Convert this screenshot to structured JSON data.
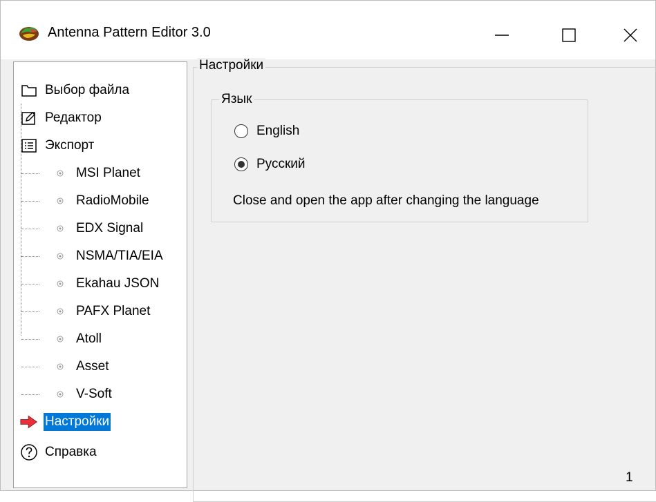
{
  "window": {
    "title": "Antenna Pattern Editor 3.0",
    "icon": "app-logo-icon",
    "controls": [
      "minimize-icon",
      "maximize-icon",
      "close-icon"
    ]
  },
  "sidebar": {
    "items": [
      {
        "label": "Выбор файла",
        "icon": "folder-icon"
      },
      {
        "label": "Редактор",
        "icon": "edit-icon"
      },
      {
        "label": "Экспорт",
        "icon": "list-icon",
        "children": [
          {
            "label": "MSI Planet"
          },
          {
            "label": "RadioMobile"
          },
          {
            "label": "EDX Signal"
          },
          {
            "label": "NSMA/TIA/EIA"
          },
          {
            "label": "Ekahau JSON"
          },
          {
            "label": "PAFX Planet"
          },
          {
            "label": "Atoll"
          },
          {
            "label": "Asset"
          },
          {
            "label": "V-Soft"
          }
        ]
      },
      {
        "label": "Настройки",
        "icon": "arrow-right-icon",
        "selected": true
      },
      {
        "label": "Справка",
        "icon": "help-icon"
      }
    ]
  },
  "settings": {
    "group_title": "Настройки",
    "language": {
      "group_title": "Язык",
      "options": [
        {
          "label": "English",
          "checked": false
        },
        {
          "label": "Русский",
          "checked": true
        }
      ],
      "note": "Close and open the app after changing the language"
    }
  },
  "status": {
    "page_number": "1"
  },
  "colors": {
    "selection": "#0078d7",
    "arrow": "#e8303a"
  }
}
